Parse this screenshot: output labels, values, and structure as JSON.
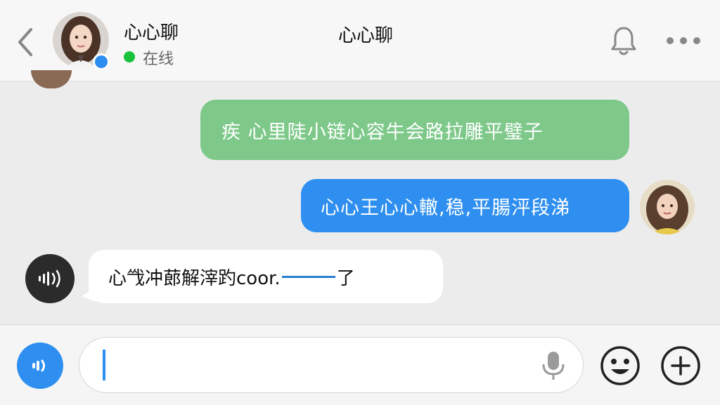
{
  "header": {
    "contact_name": "心心聊",
    "status": "在线",
    "title": "心心聊"
  },
  "messages": [
    {
      "side": "right",
      "color": "#7ec98a",
      "text": "疾 心里陡小链心容牛会路拉雕平璧子"
    },
    {
      "side": "right",
      "color": "#2f8ff0",
      "text": "心心王心心轍,稳,平腸泙段涕"
    },
    {
      "side": "left",
      "color": "#ffffff",
      "text_before": "⼼㦰冲蓈解滓趵coor.",
      "text_after": "了"
    }
  ],
  "input": {
    "value": "",
    "placeholder": ""
  },
  "colors": {
    "accent_blue": "#2f8ff0",
    "bubble_green": "#7ec98a",
    "online_green": "#19c23a",
    "background": "#ececec"
  },
  "icons": [
    "back-icon",
    "bell-icon",
    "more-icon",
    "voice-wave-icon",
    "microphone-icon",
    "emoji-icon",
    "plus-icon"
  ]
}
